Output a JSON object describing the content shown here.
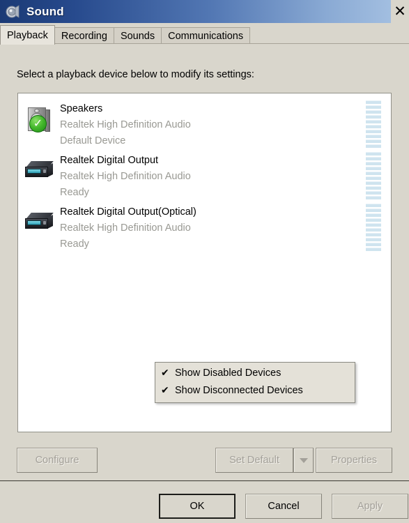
{
  "window": {
    "title": "Sound",
    "icon": "speaker-icon",
    "close_label": "✕"
  },
  "tabs": [
    {
      "label": "Playback",
      "active": true
    },
    {
      "label": "Recording",
      "active": false
    },
    {
      "label": "Sounds",
      "active": false
    },
    {
      "label": "Communications",
      "active": false
    }
  ],
  "instruction": "Select a playback device below to modify its settings:",
  "devices": [
    {
      "name": "Speakers",
      "driver": "Realtek High Definition Audio",
      "status": "Default Device",
      "icon": "speaker-device-icon",
      "is_default": true,
      "meter_segments": 10
    },
    {
      "name": "Realtek Digital Output",
      "driver": "Realtek High Definition Audio",
      "status": "Ready",
      "icon": "digital-output-icon",
      "is_default": false,
      "meter_segments": 10
    },
    {
      "name": "Realtek Digital Output(Optical)",
      "driver": "Realtek High Definition Audio",
      "status": "Ready",
      "icon": "digital-output-icon",
      "is_default": false,
      "meter_segments": 10
    }
  ],
  "context_menu": {
    "items": [
      {
        "label": "Show Disabled Devices",
        "checked": true,
        "check_glyph": "✔"
      },
      {
        "label": "Show Disconnected Devices",
        "checked": true,
        "check_glyph": "✔"
      }
    ]
  },
  "mid_buttons": {
    "configure": {
      "label": "Configure",
      "enabled": false
    },
    "set_default": {
      "label": "Set Default",
      "enabled": false
    },
    "set_default_arrow": {
      "label": "",
      "icon": "chevron-down-icon",
      "enabled": false
    },
    "properties": {
      "label": "Properties",
      "enabled": false
    }
  },
  "footer_buttons": {
    "ok": {
      "label": "OK",
      "enabled": true,
      "default": true
    },
    "cancel": {
      "label": "Cancel",
      "enabled": true
    },
    "apply": {
      "label": "Apply",
      "enabled": false
    }
  },
  "colors": {
    "dialog_bg": "#d9d6cc",
    "list_bg": "#ffffff",
    "title_start": "#1b3a75",
    "title_end": "#a9c4e4",
    "default_badge": "#2fa31f",
    "meter_segment": "#cfe4ef",
    "disabled_text": "#a3a099",
    "secondary_text": "#999993"
  }
}
